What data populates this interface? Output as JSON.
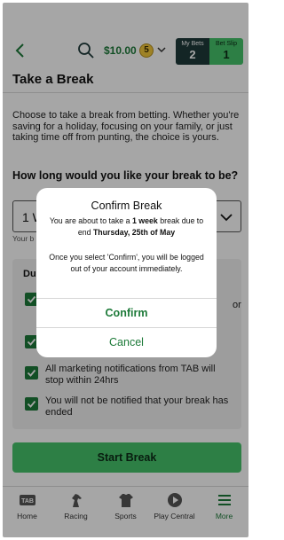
{
  "header": {
    "balance": "$10.00",
    "balance_badge": "5",
    "my_bets_label": "My Bets",
    "my_bets_count": "2",
    "bet_slip_label": "Bet Slip",
    "bet_slip_count": "1"
  },
  "page": {
    "title": "Take a Break",
    "intro": "Choose to take a break from betting. Whether you're saving for a holiday, focusing on your family, or just taking time off from punting, the choice is yours.",
    "question": "How long would you like your break to be?",
    "select_value": "1 W",
    "helper": "Your b",
    "panel_title": "Dur",
    "items": [
      {
        "text": ""
      },
      {
        "text": "or"
      },
      {
        "text": ""
      },
      {
        "text": "All marketing notifications from TAB will stop within 24hrs"
      },
      {
        "text": "You will not be notified that your break has ended"
      }
    ],
    "start_button": "Start Break"
  },
  "tabbar": {
    "items": [
      {
        "label": "Home",
        "icon": "tab-logo-icon"
      },
      {
        "label": "Racing",
        "icon": "horse-icon"
      },
      {
        "label": "Sports",
        "icon": "jersey-icon"
      },
      {
        "label": "Play Central",
        "icon": "play-icon"
      },
      {
        "label": "More",
        "icon": "menu-icon"
      }
    ]
  },
  "dialog": {
    "title": "Confirm Break",
    "body_pre": "You are about to take a ",
    "body_duration": "1 week",
    "body_mid": " break due to end ",
    "body_date": "Thursday, 25th of May",
    "body2": "Once you select 'Confirm', you will be logged out of your account immediately.",
    "confirm_label": "Confirm",
    "cancel_label": "Cancel"
  },
  "colors": {
    "accent_green": "#1d7a39",
    "button_green": "#45c46a",
    "dark_teal": "#1e3a3a"
  }
}
